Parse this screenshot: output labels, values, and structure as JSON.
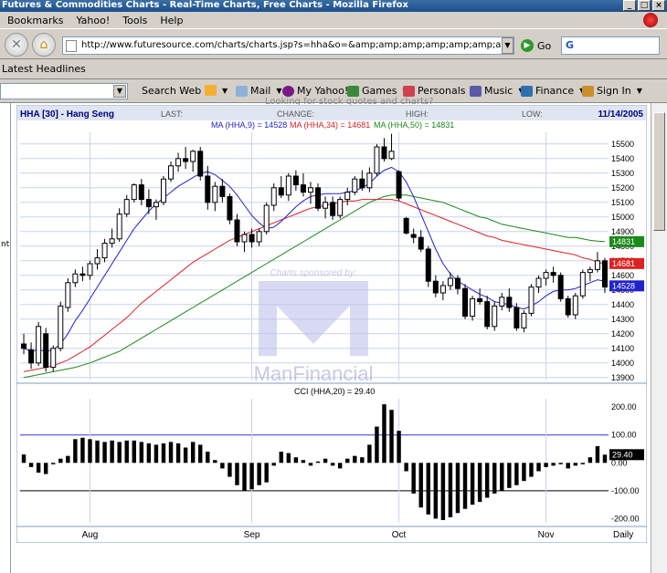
{
  "window": {
    "title": "Futures & Commodities Charts - Real-Time Charts, Free Charts - Mozilla Firefox"
  },
  "menu": [
    "Bookmarks",
    "Yahoo!",
    "Tools",
    "Help"
  ],
  "nav": {
    "url": "http://www.futuresource.com/charts/charts.jsp?s=hha&o=&amp;amp;amp;amp;amp;amp;amp;amp;amp;amp;a=D",
    "go_label": "Go",
    "search_value": "G"
  },
  "bookmarks": {
    "headlines": "Latest Headlines"
  },
  "yahoo_toolbar": {
    "items": [
      "Search Web",
      "Mail",
      "My Yahoo!",
      "Games",
      "Personals",
      "Music",
      "Finance",
      "Sign In"
    ]
  },
  "page": {
    "cut_text": "Looking for stock quotes and charts?",
    "left_pane_text": "nt"
  },
  "chart_data": {
    "type": "candlestick",
    "header": {
      "symbol": "HHA [30] - Hang Seng",
      "last_label": "LAST:",
      "change_label": "CHANGE:",
      "high_label": "HIGH:",
      "low_label": "LOW:",
      "date": "11/14/2005"
    },
    "ma_legend": [
      {
        "label": "MA (HHA,9) = 14528",
        "color": "#2222cc"
      },
      {
        "label": "MA (HHA,34) = 14681",
        "color": "#dd2222"
      },
      {
        "label": "MA (HHA,50) = 14831",
        "color": "#1a8a1a"
      }
    ],
    "sponsor": {
      "caption": "Charts sponsored by:",
      "brand": "ManFinancial"
    },
    "y_ticks": [
      15500,
      15400,
      15300,
      15200,
      15100,
      15000,
      14900,
      14800,
      14700,
      14600,
      14500,
      14400,
      14300,
      14200,
      14100,
      14000,
      13900
    ],
    "ylim": [
      13880,
      15580
    ],
    "value_tags": [
      {
        "value": 14831,
        "text": "14831",
        "color": "#1a8a1a"
      },
      {
        "value": 14681,
        "text": "14681",
        "color": "#dd2222"
      },
      {
        "value": 14528,
        "text": "14528",
        "color": "#2222cc"
      }
    ],
    "x_labels": [
      {
        "index": 9,
        "label": "Aug"
      },
      {
        "index": 31,
        "label": "Sep"
      },
      {
        "index": 51,
        "label": "Oct"
      },
      {
        "index": 71,
        "label": "Nov"
      }
    ],
    "period_label": "Daily",
    "candles": [
      [
        14130,
        14200,
        14060,
        14100
      ],
      [
        14090,
        14140,
        13960,
        14000
      ],
      [
        14000,
        14280,
        13980,
        14250
      ],
      [
        14200,
        14240,
        13940,
        13970
      ],
      [
        13970,
        14120,
        13940,
        14100
      ],
      [
        14100,
        14420,
        14080,
        14390
      ],
      [
        14380,
        14580,
        14350,
        14550
      ],
      [
        14550,
        14640,
        14520,
        14610
      ],
      [
        14610,
        14660,
        14560,
        14600
      ],
      [
        14600,
        14700,
        14570,
        14680
      ],
      [
        14680,
        14780,
        14640,
        14720
      ],
      [
        14720,
        14850,
        14690,
        14820
      ],
      [
        14820,
        14920,
        14790,
        14850
      ],
      [
        14850,
        15060,
        14830,
        15020
      ],
      [
        15020,
        15150,
        15000,
        15120
      ],
      [
        15120,
        15230,
        15100,
        15220
      ],
      [
        15220,
        15260,
        15080,
        15120
      ],
      [
        15120,
        15190,
        15020,
        15070
      ],
      [
        15070,
        15120,
        14980,
        15100
      ],
      [
        15100,
        15280,
        15080,
        15260
      ],
      [
        15260,
        15380,
        15240,
        15350
      ],
      [
        15350,
        15440,
        15310,
        15400
      ],
      [
        15400,
        15480,
        15330,
        15380
      ],
      [
        15380,
        15460,
        15310,
        15450
      ],
      [
        15450,
        15480,
        15250,
        15280
      ],
      [
        15280,
        15350,
        15050,
        15100
      ],
      [
        15100,
        15240,
        15040,
        15210
      ],
      [
        15210,
        15260,
        15100,
        15140
      ],
      [
        15140,
        15160,
        14950,
        14980
      ],
      [
        14980,
        15020,
        14800,
        14830
      ],
      [
        14830,
        14900,
        14760,
        14880
      ],
      [
        14880,
        14920,
        14790,
        14830
      ],
      [
        14830,
        14920,
        14800,
        14900
      ],
      [
        14900,
        15100,
        14880,
        15080
      ],
      [
        15080,
        15230,
        15040,
        15200
      ],
      [
        15200,
        15280,
        15130,
        15150
      ],
      [
        15150,
        15300,
        15110,
        15280
      ],
      [
        15280,
        15320,
        15180,
        15220
      ],
      [
        15220,
        15300,
        15140,
        15170
      ],
      [
        15170,
        15240,
        15090,
        15200
      ],
      [
        15200,
        15230,
        15040,
        15060
      ],
      [
        15060,
        15140,
        14990,
        15100
      ],
      [
        15100,
        15140,
        14980,
        15010
      ],
      [
        15010,
        15140,
        14990,
        15120
      ],
      [
        15120,
        15200,
        15080,
        15170
      ],
      [
        15170,
        15280,
        15150,
        15260
      ],
      [
        15260,
        15320,
        15180,
        15200
      ],
      [
        15200,
        15340,
        15170,
        15300
      ],
      [
        15300,
        15500,
        15280,
        15480
      ],
      [
        15480,
        15540,
        15380,
        15400
      ],
      [
        15400,
        15570,
        15390,
        15450
      ],
      [
        15310,
        15320,
        15110,
        15130
      ],
      [
        14990,
        15000,
        14880,
        14890
      ],
      [
        14880,
        14920,
        14820,
        14860
      ],
      [
        14860,
        14910,
        14760,
        14780
      ],
      [
        14780,
        14800,
        14520,
        14560
      ],
      [
        14560,
        14600,
        14450,
        14480
      ],
      [
        14480,
        14560,
        14430,
        14530
      ],
      [
        14530,
        14620,
        14500,
        14580
      ],
      [
        14580,
        14600,
        14470,
        14510
      ],
      [
        14510,
        14540,
        14300,
        14320
      ],
      [
        14320,
        14460,
        14290,
        14440
      ],
      [
        14440,
        14510,
        14400,
        14420
      ],
      [
        14420,
        14460,
        14230,
        14250
      ],
      [
        14250,
        14420,
        14220,
        14390
      ],
      [
        14390,
        14480,
        14360,
        14450
      ],
      [
        14450,
        14510,
        14350,
        14380
      ],
      [
        14380,
        14410,
        14220,
        14240
      ],
      [
        14240,
        14360,
        14210,
        14340
      ],
      [
        14340,
        14540,
        14320,
        14520
      ],
      [
        14520,
        14600,
        14480,
        14580
      ],
      [
        14580,
        14640,
        14530,
        14620
      ],
      [
        14620,
        14660,
        14550,
        14600
      ],
      [
        14600,
        14620,
        14420,
        14440
      ],
      [
        14440,
        14460,
        14310,
        14330
      ],
      [
        14330,
        14480,
        14300,
        14460
      ],
      [
        14460,
        14640,
        14440,
        14620
      ],
      [
        14620,
        14660,
        14560,
        14640
      ],
      [
        14640,
        14760,
        14620,
        14700
      ],
      [
        14700,
        14720,
        14480,
        14520
      ]
    ],
    "ma9": [
      14100,
      14080,
      14090,
      14080,
      14090,
      14130,
      14200,
      14290,
      14360,
      14440,
      14520,
      14600,
      14680,
      14760,
      14840,
      14920,
      14980,
      15040,
      15090,
      15130,
      15170,
      15210,
      15240,
      15270,
      15300,
      15310,
      15290,
      15250,
      15210,
      15150,
      15080,
      15010,
      14960,
      14920,
      14930,
      14970,
      15020,
      15070,
      15110,
      15140,
      15150,
      15160,
      15160,
      15160,
      15170,
      15180,
      15200,
      15230,
      15280,
      15320,
      15340,
      15310,
      15240,
      15140,
      15020,
      14900,
      14780,
      14680,
      14610,
      14560,
      14530,
      14500,
      14470,
      14450,
      14420,
      14410,
      14400,
      14380,
      14370,
      14390,
      14420,
      14460,
      14490,
      14500,
      14500,
      14510,
      14530,
      14550,
      14570,
      14560
    ],
    "ma34": [
      13940,
      13950,
      13960,
      13970,
      13980,
      14000,
      14020,
      14050,
      14080,
      14110,
      14150,
      14190,
      14230,
      14270,
      14310,
      14360,
      14410,
      14450,
      14490,
      14530,
      14570,
      14610,
      14650,
      14690,
      14720,
      14750,
      14780,
      14810,
      14840,
      14860,
      14880,
      14900,
      14920,
      14940,
      14960,
      14980,
      15000,
      15020,
      15040,
      15060,
      15070,
      15080,
      15090,
      15100,
      15110,
      15110,
      15120,
      15120,
      15120,
      15120,
      15120,
      15110,
      15090,
      15070,
      15050,
      15030,
      15010,
      14990,
      14970,
      14950,
      14930,
      14910,
      14890,
      14870,
      14860,
      14840,
      14830,
      14820,
      14810,
      14800,
      14790,
      14780,
      14770,
      14760,
      14750,
      14740,
      14720,
      14710,
      14690,
      14680
    ],
    "ma50": [
      13900,
      13910,
      13920,
      13930,
      13940,
      13950,
      13960,
      13970,
      13985,
      14000,
      14020,
      14040,
      14060,
      14080,
      14110,
      14140,
      14170,
      14200,
      14230,
      14260,
      14290,
      14320,
      14350,
      14380,
      14410,
      14440,
      14470,
      14500,
      14530,
      14560,
      14590,
      14620,
      14650,
      14680,
      14710,
      14740,
      14770,
      14800,
      14830,
      14860,
      14890,
      14920,
      14950,
      14980,
      15010,
      15040,
      15070,
      15100,
      15120,
      15140,
      15150,
      15150,
      15150,
      15140,
      15130,
      15120,
      15110,
      15100,
      15080,
      15060,
      15040,
      15020,
      15000,
      14990,
      14970,
      14950,
      14940,
      14930,
      14920,
      14910,
      14900,
      14890,
      14880,
      14870,
      14860,
      14860,
      14850,
      14840,
      14835,
      14831
    ],
    "cci": {
      "label": "CCI (HHA,20) = 29.40",
      "last_text": "29.40",
      "ticks": [
        200,
        100,
        0,
        -100,
        -200
      ],
      "tick_labels": [
        "200.00",
        "100.00",
        "0.00",
        "-100.00",
        "-200.00"
      ],
      "ylim": [
        -215,
        230
      ],
      "ref_lines": [
        {
          "value": 100,
          "color": "#3333cc"
        },
        {
          "value": -100,
          "color": "#000000"
        }
      ],
      "values": [
        30,
        -15,
        -35,
        -40,
        -5,
        15,
        25,
        85,
        90,
        85,
        80,
        75,
        80,
        75,
        80,
        80,
        75,
        70,
        65,
        70,
        75,
        70,
        55,
        75,
        65,
        40,
        10,
        -20,
        -50,
        -80,
        -100,
        -95,
        -80,
        -70,
        -10,
        40,
        35,
        20,
        10,
        -10,
        5,
        15,
        -10,
        -20,
        15,
        25,
        20,
        65,
        130,
        210,
        190,
        115,
        -30,
        -110,
        -160,
        -185,
        -200,
        -205,
        -195,
        -180,
        -165,
        -150,
        -140,
        -125,
        -110,
        -100,
        -90,
        -80,
        -65,
        -50,
        -30,
        -15,
        -10,
        -5,
        -20,
        -10,
        -5,
        20,
        60,
        29.4
      ]
    }
  }
}
